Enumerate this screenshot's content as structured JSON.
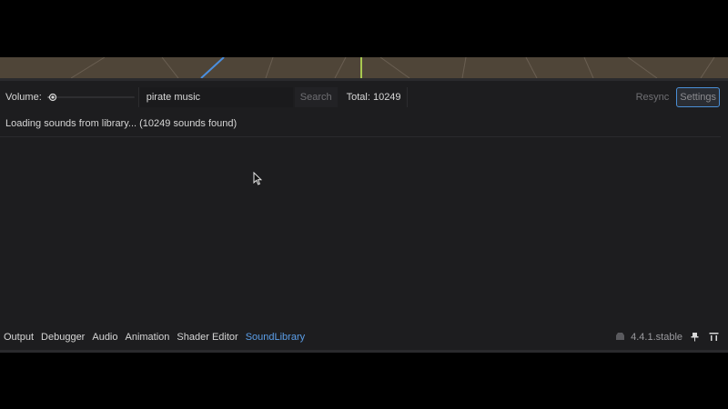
{
  "toolbar": {
    "volume_label": "Volume:",
    "search_value": "pirate music",
    "search_button": "Search",
    "total_label": "Total: 10249",
    "resync_button": "Resync",
    "settings_button": "Settings"
  },
  "status": {
    "message": "Loading sounds from library... (10249 sounds found)"
  },
  "bottom_tabs": [
    {
      "label": "Output"
    },
    {
      "label": "Debugger"
    },
    {
      "label": "Audio"
    },
    {
      "label": "Animation"
    },
    {
      "label": "Shader Editor"
    },
    {
      "label": "SoundLibrary"
    }
  ],
  "active_tab": "SoundLibrary",
  "version": "4.4.1.stable",
  "icons": {
    "volume_grabber": "slider-grabber-icon",
    "version": "godot-icon",
    "pin": "pin-icon",
    "expand": "expand-panel-icon",
    "cursor": "mouse-cursor-icon"
  },
  "colors": {
    "panel_bg": "#1d1d1f",
    "accent": "#5b9ee8",
    "viewport": "#4f4538"
  }
}
